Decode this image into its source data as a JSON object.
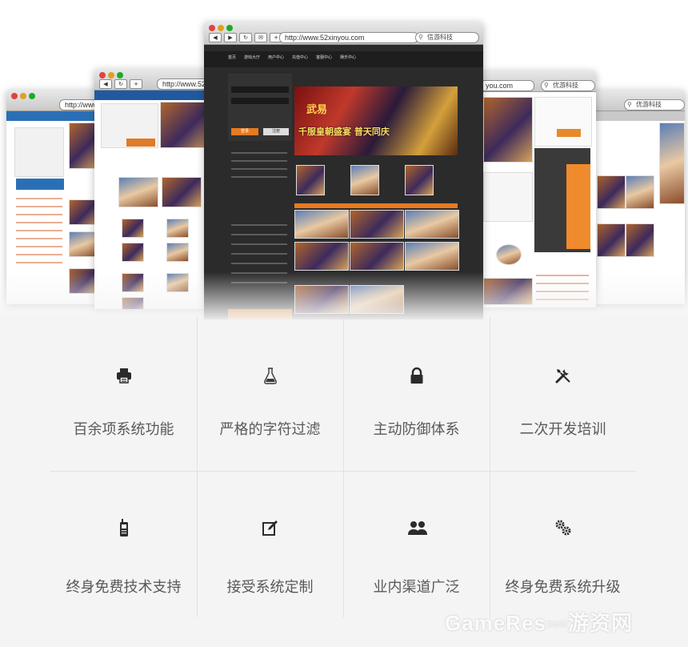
{
  "browsers": {
    "back_window": {
      "url": "http://www.52",
      "search": ""
    },
    "left_window": {
      "url": "http://www.52xin",
      "search": ""
    },
    "main_window": {
      "url": "http://www.52xinyou.com",
      "search": "信游科技"
    },
    "right_window": {
      "url": "you.com",
      "search": "优游科技"
    },
    "far_right_window": {
      "url": "",
      "search": "优游科技"
    }
  },
  "hero_page": {
    "nav": [
      "首页",
      "游戏大厅",
      "用户中心",
      "充值中心",
      "客服中心",
      "娱乐中心"
    ],
    "banner_title": "千服皇朝盛宴 普天同庆",
    "banner_logo": "武易",
    "login_button": "登录",
    "register_button": "注册"
  },
  "features": [
    {
      "icon": "printer-icon",
      "label": "百余项系统功能"
    },
    {
      "icon": "flask-icon",
      "label": "严格的字符过滤"
    },
    {
      "icon": "lock-icon",
      "label": "主动防御体系"
    },
    {
      "icon": "tools-icon",
      "label": "二次开发培训"
    },
    {
      "icon": "mobile-phone-icon",
      "label": "终身免费技术支持"
    },
    {
      "icon": "edit-icon",
      "label": "接受系统定制"
    },
    {
      "icon": "users-icon",
      "label": "业内渠道广泛"
    },
    {
      "icon": "gears-icon",
      "label": "终身免费系统升级"
    }
  ],
  "watermark": {
    "main": "GameRes",
    "small": "游资网",
    "cn": "游资网"
  }
}
